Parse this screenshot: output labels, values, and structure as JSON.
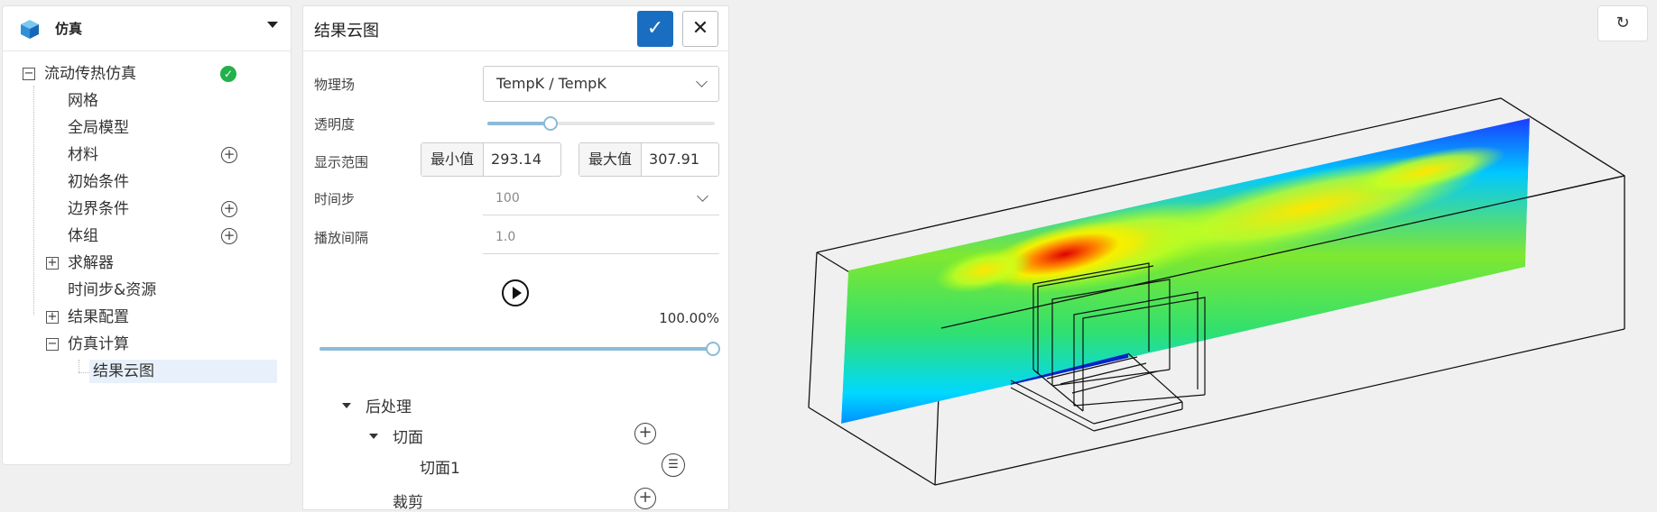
{
  "project": {
    "name": "仿真",
    "icon": "cube-icon"
  },
  "tree": {
    "root": {
      "label": "流动传热仿真",
      "status": "success"
    },
    "items": [
      {
        "label": "网格"
      },
      {
        "label": "全局模型"
      },
      {
        "label": "材料",
        "addable": true
      },
      {
        "label": "初始条件"
      },
      {
        "label": "边界条件",
        "addable": true
      },
      {
        "label": "体组",
        "addable": true
      },
      {
        "label": "求解器",
        "expandable": true,
        "expanded": false
      },
      {
        "label": "时间步&资源"
      },
      {
        "label": "结果配置",
        "expandable": true,
        "expanded": false
      },
      {
        "label": "仿真计算",
        "expandable": true,
        "expanded": true
      }
    ],
    "selected_child": {
      "label": "结果云图"
    }
  },
  "panel": {
    "title": "结果云图",
    "fields": {
      "physics_label": "物理场",
      "physics_value": "TempK / TempK",
      "opacity_label": "透明度",
      "opacity_fraction": 0.3,
      "range_label": "显示范围",
      "min_label": "最小值",
      "min_value": "293.14",
      "max_label": "最大值",
      "max_value": "307.91",
      "timestep_label": "时间步",
      "timestep_value": "100",
      "interval_label": "播放间隔",
      "interval_value": "1.0"
    },
    "playback": {
      "progress_text": "100.00%",
      "progress_fraction": 1.0
    },
    "post": {
      "root_label": "后处理",
      "section_label": "切面",
      "item_label": "切面1",
      "next_label": "裁剪"
    }
  },
  "viewport": {
    "refresh_icon": "refresh-icon",
    "colormap": "jet"
  }
}
